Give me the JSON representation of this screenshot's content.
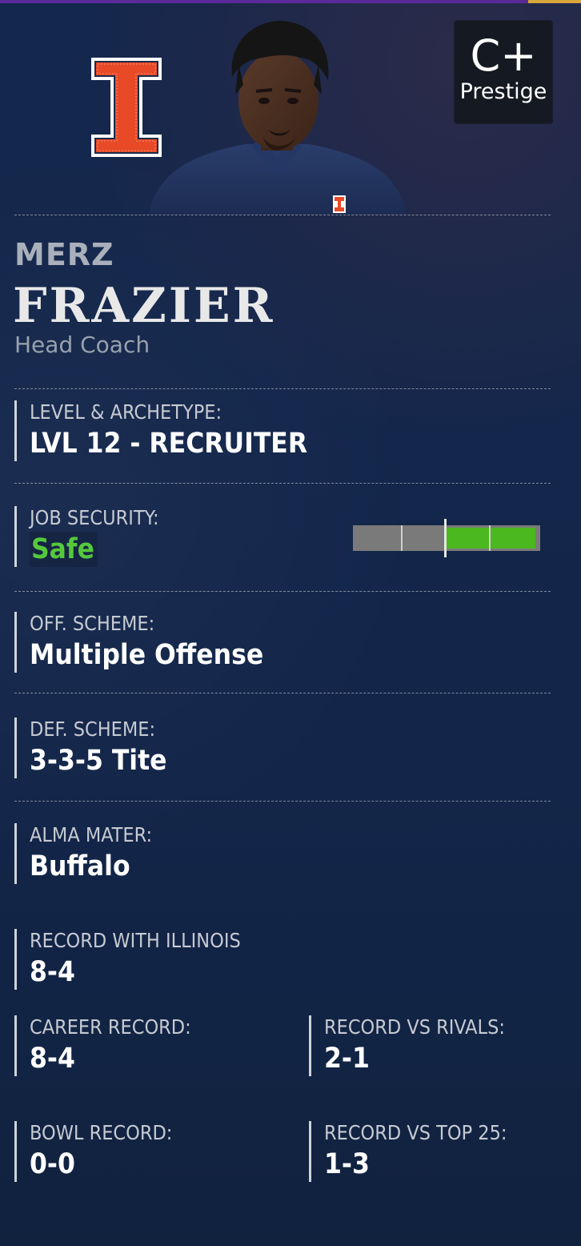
{
  "prestige": {
    "grade": "C+",
    "label": "Prestige"
  },
  "coach": {
    "first_name": "MERZ",
    "last_name": "FRAZIER",
    "role": "Head Coach"
  },
  "fields": {
    "level": {
      "label": "LEVEL & ARCHETYPE:",
      "value": "LVL 12 - RECRUITER"
    },
    "job_security": {
      "label": "JOB SECURITY:",
      "value": "Safe",
      "level_fraction": 0.7
    },
    "off_scheme": {
      "label": "OFF. SCHEME:",
      "value": "Multiple Offense"
    },
    "def_scheme": {
      "label": "DEF. SCHEME:",
      "value": "3-3-5 Tite"
    },
    "alma_mater": {
      "label": "ALMA MATER:",
      "value": "Buffalo"
    },
    "record_school": {
      "label": "RECORD WITH ILLINOIS",
      "value": "8-4"
    },
    "career_record": {
      "label": "CAREER RECORD:",
      "value": "8-4"
    },
    "rivals_record": {
      "label": "RECORD VS RIVALS:",
      "value": "2-1"
    },
    "bowl_record": {
      "label": "BOWL RECORD:",
      "value": "0-0"
    },
    "top25_record": {
      "label": "RECORD VS TOP 25:",
      "value": "1-3"
    }
  },
  "colors": {
    "background": "#13264a",
    "school_orange": "#e84a27",
    "safe_green": "#4cb81f"
  },
  "icons": {
    "school_logo": "illinois-block-i-logo",
    "coach_photo": "coach-portrait"
  }
}
